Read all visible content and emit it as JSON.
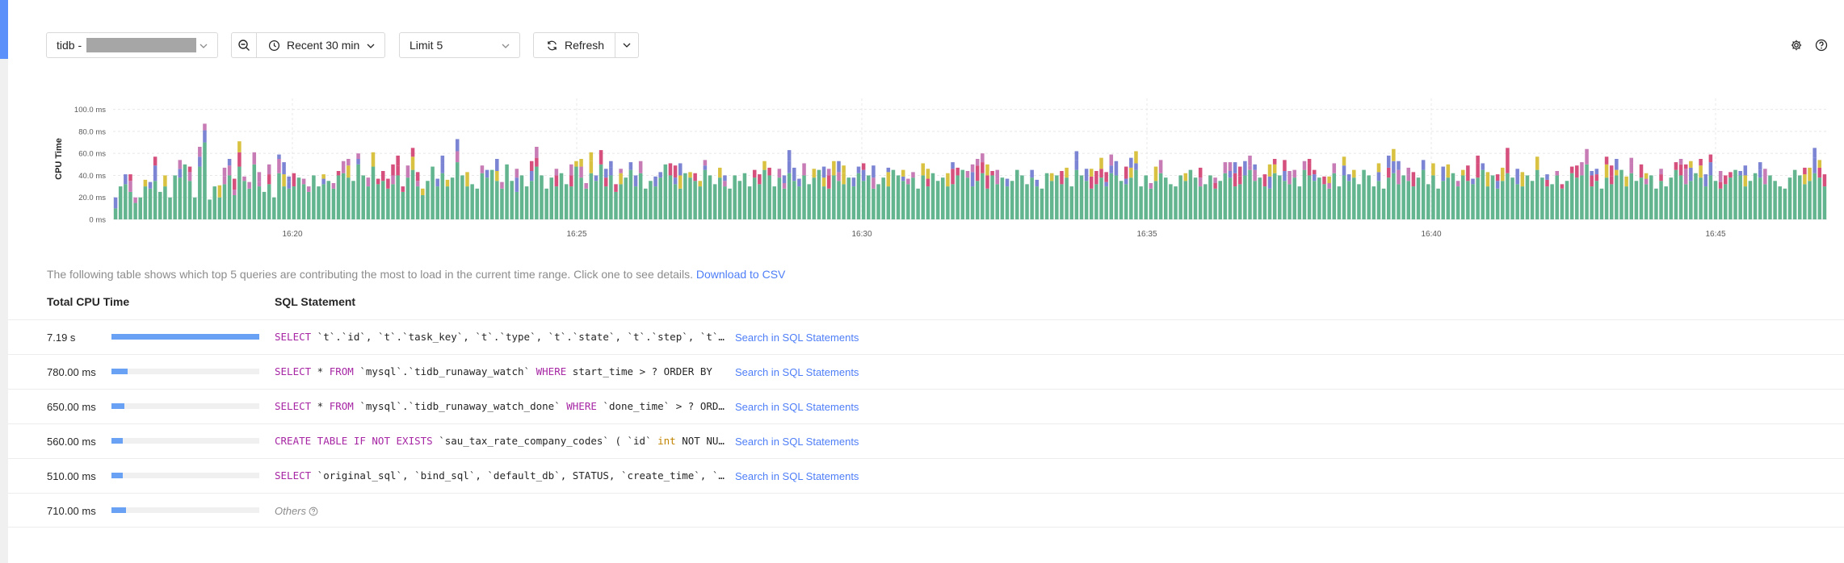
{
  "toolbar": {
    "instance_prefix": "tidb -",
    "time_range": "Recent 30 min",
    "limit": "Limit 5",
    "refresh": "Refresh"
  },
  "icons": {
    "instance_dropdown": "chevron-down-icon",
    "zoom_out": "zoom-out-icon",
    "time": "clock-icon",
    "limit_dropdown": "chevron-down-icon",
    "refresh": "refresh-icon",
    "refresh_dropdown": "chevron-down-icon",
    "settings": "gear-icon",
    "help": "question-icon"
  },
  "chart_data": {
    "type": "bar",
    "stacked": true,
    "ylabel": "CPU Time",
    "yticks": [
      "0 ms",
      "20.0 ms",
      "40.0 ms",
      "60.0 ms",
      "80.0 ms",
      "100.0 ms"
    ],
    "ylim": [
      0,
      110
    ],
    "xticks": [
      "16:20",
      "16:25",
      "16:30",
      "16:35",
      "16:40",
      "16:45"
    ],
    "grid": true,
    "colors": [
      "#62b58f",
      "#7c85d3",
      "#c87cb6",
      "#d9c242",
      "#d6507e"
    ],
    "series": [
      {
        "values": [
          10,
          30,
          32,
          25,
          15,
          20,
          30,
          28,
          35,
          25,
          30,
          20,
          40,
          38,
          50,
          35,
          20,
          48,
          70,
          18,
          30,
          20,
          32,
          40,
          22,
          48,
          35,
          28,
          50,
          30,
          25,
          32,
          20,
          42,
          30,
          28,
          30,
          38,
          32,
          25,
          40,
          30,
          32,
          35,
          28,
          40,
          42,
          38,
          35,
          50,
          40,
          30,
          48,
          32,
          35,
          28,
          32,
          40,
          25,
          38,
          45,
          30,
          22,
          35,
          48,
          30,
          42,
          30,
          38,
          52,
          40,
          30,
          32,
          28,
          42,
          38,
          45,
          35,
          28,
          50,
          35,
          25,
          40,
          30,
          35,
          48,
          40,
          28,
          38,
          30,
          42,
          32,
          30,
          48,
          38,
          28,
          42,
          35,
          50,
          30,
          40,
          25,
          32,
          38,
          45,
          30,
          42,
          28,
          35,
          30,
          38,
          50,
          40,
          32,
          28,
          42,
          38,
          35,
          30,
          45,
          40,
          32,
          38,
          30,
          28,
          40,
          35,
          42,
          30,
          38,
          32,
          45,
          40,
          30,
          38,
          28,
          42,
          35,
          30,
          40,
          32,
          38,
          45,
          30,
          28,
          40,
          35,
          32,
          38,
          30,
          42,
          35,
          40,
          28,
          32,
          38,
          30,
          45,
          40,
          35,
          32,
          38,
          28,
          40,
          30,
          42,
          35,
          38,
          30,
          32,
          40,
          45,
          38,
          30,
          35,
          42,
          28,
          40,
          32,
          38,
          30,
          35,
          45,
          40,
          32,
          38,
          30,
          28,
          42,
          35,
          40,
          32,
          38,
          30,
          45,
          40,
          35,
          28,
          32,
          38,
          30,
          42,
          40,
          35,
          32,
          38,
          45,
          30,
          40,
          28,
          35,
          42,
          38,
          32,
          30,
          40,
          35,
          45,
          38,
          30,
          32,
          40,
          28,
          35,
          42,
          38,
          30,
          32,
          40,
          45,
          35,
          38,
          30,
          28,
          42,
          40,
          35,
          32,
          38,
          30,
          45,
          40,
          35,
          38,
          32,
          28,
          42,
          30,
          40,
          35,
          38,
          32,
          45,
          40,
          30,
          35,
          28,
          38,
          42,
          32,
          40,
          35,
          30,
          38,
          45,
          32,
          40,
          28,
          35,
          38,
          42,
          30,
          40,
          35,
          32,
          38,
          45,
          30,
          40,
          28,
          35,
          42,
          38,
          32,
          30,
          40,
          35,
          45,
          38,
          30,
          32,
          40,
          28,
          35,
          42,
          38,
          40,
          50,
          30,
          35,
          28,
          38,
          32,
          40,
          45,
          30,
          42,
          35,
          38,
          32,
          40,
          28,
          35,
          30,
          38,
          45,
          40,
          32,
          35,
          42,
          38,
          30,
          40,
          35,
          28,
          32,
          38,
          45,
          40,
          30,
          35,
          42,
          38,
          32,
          40,
          35,
          30,
          28,
          38,
          45,
          40,
          32,
          35,
          42,
          38,
          30
        ]
      },
      {
        "values": [
          0,
          5,
          0,
          0,
          0,
          0,
          0,
          10,
          0,
          0,
          15,
          0,
          0,
          0,
          0,
          0,
          0,
          0,
          0,
          0,
          0,
          0,
          0,
          0,
          0,
          10,
          0,
          0,
          0,
          0,
          0,
          0,
          0,
          0,
          0,
          0,
          0,
          0,
          0,
          0,
          0,
          0,
          0,
          0,
          0,
          0,
          0,
          0,
          0,
          0,
          0,
          0,
          0,
          0,
          0,
          0,
          0,
          0,
          0,
          0,
          0,
          0,
          0,
          0,
          0,
          0,
          0,
          0,
          0,
          0,
          0,
          0,
          0,
          0,
          0,
          0,
          0,
          0,
          0,
          0,
          0,
          0,
          0,
          0,
          0,
          0,
          0,
          0,
          0,
          0,
          0,
          0,
          0,
          0,
          0,
          0,
          0,
          0,
          0,
          0,
          0,
          0,
          0,
          0,
          0,
          0,
          0,
          0,
          0,
          0,
          0,
          0,
          0,
          0,
          0,
          0,
          0,
          0,
          0,
          0,
          0,
          0,
          0,
          0,
          0,
          0,
          0,
          0,
          0,
          0,
          0,
          0,
          0,
          0,
          0,
          0,
          0,
          0,
          0,
          0,
          0,
          0,
          0,
          0,
          0,
          0,
          0,
          0,
          0,
          0,
          0,
          0,
          0,
          0,
          0,
          0,
          0,
          0,
          0,
          0,
          0,
          0,
          0,
          0,
          0,
          0,
          0,
          0,
          0,
          0,
          0,
          0,
          0,
          0,
          0,
          0,
          0,
          0,
          0,
          0,
          0,
          0,
          0,
          0,
          0,
          0,
          0,
          0,
          0,
          0,
          0,
          0,
          0,
          0,
          0,
          0,
          0,
          0,
          0,
          0,
          0,
          0,
          0,
          0,
          0,
          0,
          0,
          0,
          0,
          0,
          0,
          0,
          0,
          0,
          0,
          0,
          0,
          0,
          0,
          0,
          0,
          0,
          0,
          0,
          0,
          0,
          0,
          0,
          0,
          0,
          0,
          0,
          0,
          0,
          0,
          0,
          0,
          0,
          0,
          0,
          0,
          0,
          0,
          0,
          0,
          0,
          0,
          0,
          0,
          0,
          0,
          0,
          0,
          0,
          0,
          0,
          0,
          0,
          0,
          0,
          0,
          0,
          0,
          0,
          0,
          0,
          0,
          0,
          0,
          0,
          0,
          0,
          0,
          0,
          0,
          0,
          0,
          0,
          0,
          0,
          0,
          0,
          0,
          0,
          0,
          0,
          0,
          0,
          0,
          0,
          0,
          0,
          0,
          0,
          0,
          0,
          0,
          0,
          0,
          0,
          0,
          0,
          0,
          0,
          0,
          0,
          0,
          0,
          0,
          0,
          0,
          0,
          0,
          0,
          0,
          0,
          0,
          0,
          0,
          0,
          0,
          0,
          0,
          0,
          0,
          0,
          0,
          0,
          0,
          0,
          0,
          0,
          0,
          0,
          0,
          0,
          0,
          0,
          0,
          0,
          0,
          0,
          0,
          0,
          0,
          0,
          0,
          0
        ]
      }
    ]
  },
  "table": {
    "note": "The following table shows which top 5 queries are contributing the most to load in the current time range. Click one to see details.",
    "download_link": "Download to CSV",
    "col_total": "Total CPU Time",
    "col_sql": "SQL Statement",
    "search_label": "Search in SQL Statements",
    "others_label": "Others",
    "rows": [
      {
        "total": "7.19 s",
        "share": 1.0,
        "sql_kw": "SELECT",
        "sql_rest": " `t`.`id`, `t`.`task_key`, `t`.`type`, `t`.`state`, `t`.`step`, `t`.`priority`"
      },
      {
        "total": "780.00 ms",
        "share": 0.108,
        "sql_kw": "SELECT",
        "sql_mid1": " * ",
        "sql_kw2": "FROM",
        "sql_mid2": " `mysql`.`tidb_runaway_watch` ",
        "sql_kw3": "WHERE",
        "sql_rest": " start_time > ? ORDER BY"
      },
      {
        "total": "650.00 ms",
        "share": 0.09,
        "sql_kw": "SELECT",
        "sql_mid1": " * ",
        "sql_kw2": "FROM",
        "sql_mid2": " `mysql`.`tidb_runaway_watch_done` ",
        "sql_kw3": "WHERE",
        "sql_rest": " `done_time` > ? ORDER BY"
      },
      {
        "total": "560.00 ms",
        "share": 0.078,
        "sql_kw": "CREATE TABLE IF NOT EXISTS",
        "sql_mid1": " `sau_tax_rate_company_codes` ( `id` ",
        "sql_ty": "int",
        "sql_rest": " NOT NULL"
      },
      {
        "total": "510.00 ms",
        "share": 0.071,
        "sql_kw": "SELECT",
        "sql_rest": " `original_sql`, `bind_sql`, `default_db`, STATUS, `create_time`, `update_time`"
      },
      {
        "total": "710.00 ms",
        "share": 0.099
      }
    ]
  }
}
